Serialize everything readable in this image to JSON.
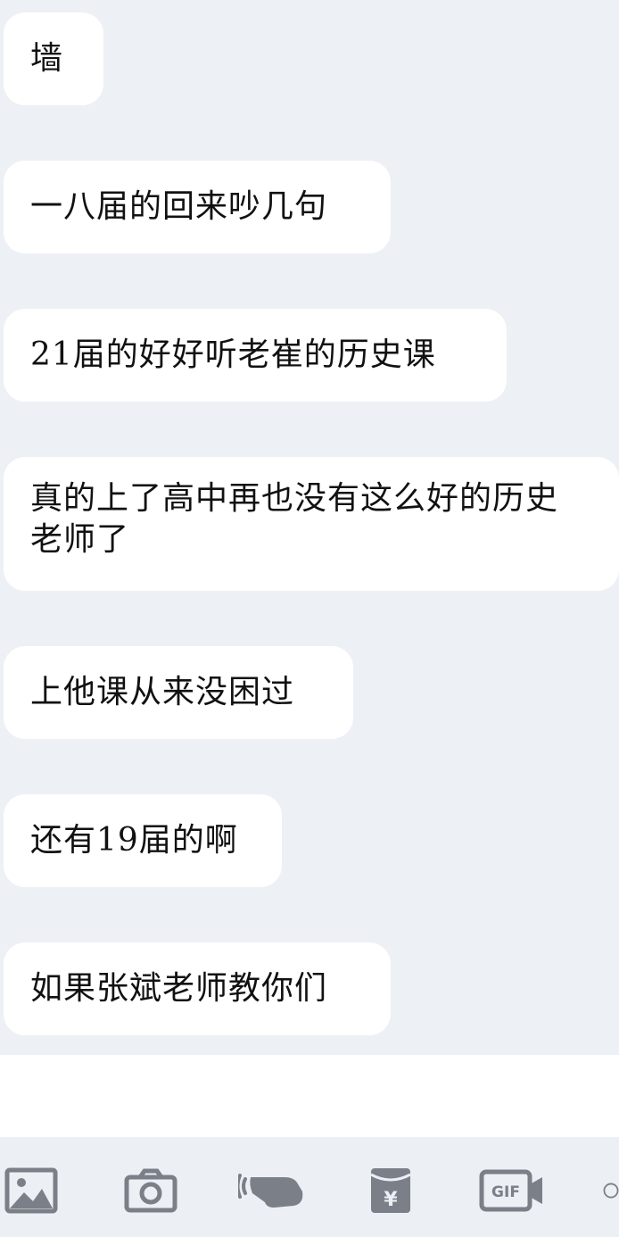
{
  "messages": [
    {
      "text": "墙"
    },
    {
      "text": "一八届的回来吵几句"
    },
    {
      "text": "21届的好好听老崔的历史课"
    },
    {
      "text": "真的上了高中再也没有这么好的历史老师了"
    },
    {
      "text": "上他课从来没困过"
    },
    {
      "text": "还有19届的啊"
    },
    {
      "text": "如果张斌老师教你们"
    }
  ],
  "toolbar": {
    "gif_label": "GIF",
    "items": [
      "image-icon",
      "camera-icon",
      "poke-icon",
      "red-packet-icon",
      "gif-icon",
      "more-icon"
    ]
  },
  "colors": {
    "chat_background": "#edf0f5",
    "bubble": "#ffffff",
    "text": "#111111",
    "icon": "#7a7f88"
  }
}
